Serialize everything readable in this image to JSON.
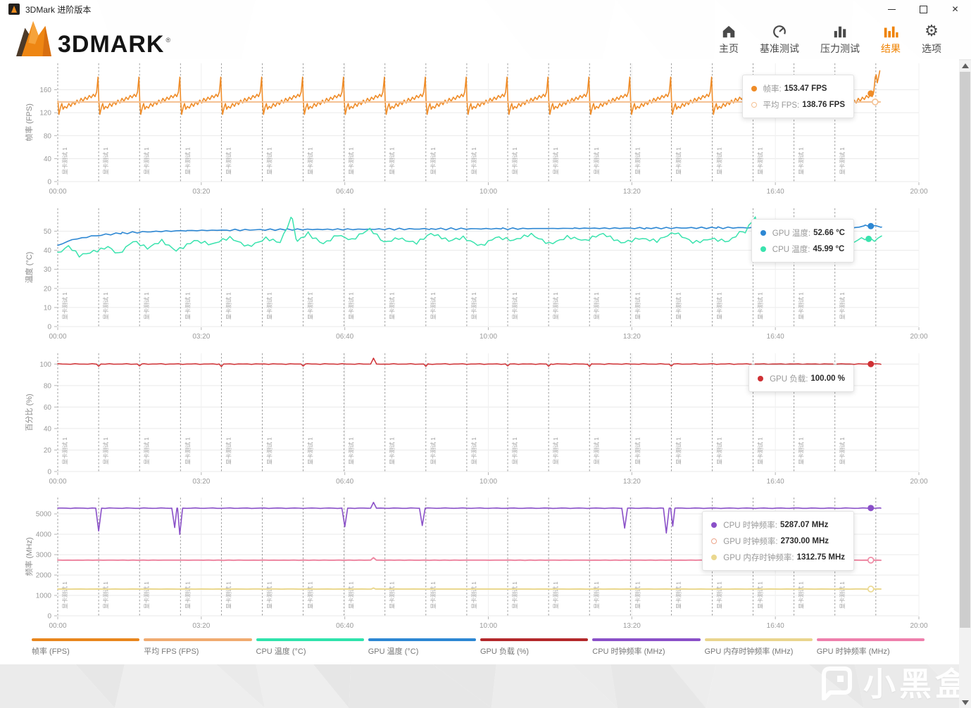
{
  "window": {
    "title": "3DMark 进阶版本",
    "controls": {
      "minimize": "最小化",
      "maximize": "最大化",
      "close": "关闭"
    }
  },
  "header": {
    "logo_text": "3DMARK",
    "reg_mark": "®",
    "nav": [
      {
        "label": "主页",
        "icon": "home-icon",
        "active": false
      },
      {
        "label": "基准测试",
        "icon": "benchmark-icon",
        "active": false
      },
      {
        "label": "压力测试",
        "icon": "stress-test-icon",
        "active": false
      },
      {
        "label": "结果",
        "icon": "results-icon",
        "active": true
      },
      {
        "label": "选项",
        "icon": "options-icon",
        "active": false
      }
    ]
  },
  "accent_color": "#ef8200",
  "loop_marker_label": "显卡测试 1",
  "chart_data": [
    {
      "type": "line",
      "ylabel": "帧率 (FPS)",
      "yticks": [
        0,
        40,
        80,
        120,
        160
      ],
      "ylim": [
        0,
        206
      ],
      "x_ticks": [
        "00:00",
        "03:20",
        "06:40",
        "10:00",
        "13:20",
        "16:40",
        "20:00"
      ],
      "x_range_seconds": [
        0,
        1200
      ],
      "loop_label": "显卡测试 1",
      "loop_period_s": 57,
      "loop_count": 21,
      "legend_rows": [
        {
          "color": "#ef8c28",
          "style": "filled",
          "label": "帧率:",
          "value": "153.47 FPS"
        },
        {
          "color": "#f4c193",
          "style": "hollow",
          "label": "平均 FPS:",
          "value": "138.76 FPS"
        }
      ],
      "series": [
        {
          "name": "帧率 (FPS)",
          "color": "#ef8c28",
          "width": 1.6,
          "data": {
            "kind": "cycle",
            "period": 57,
            "loops": 20,
            "cycle": [
              [
                0.005,
                140
              ],
              [
                0.03,
                117
              ],
              [
                0.07,
                130
              ],
              [
                0.1,
                136
              ],
              [
                0.13,
                126
              ],
              [
                0.17,
                131
              ],
              [
                0.22,
                128
              ],
              [
                0.27,
                136
              ],
              [
                0.32,
                131
              ],
              [
                0.37,
                139
              ],
              [
                0.42,
                134
              ],
              [
                0.47,
                142
              ],
              [
                0.52,
                137
              ],
              [
                0.57,
                145
              ],
              [
                0.62,
                140
              ],
              [
                0.67,
                147
              ],
              [
                0.72,
                143
              ],
              [
                0.77,
                150
              ],
              [
                0.82,
                146
              ],
              [
                0.87,
                152
              ],
              [
                0.91,
                148
              ],
              [
                0.95,
                156
              ],
              [
                0.985,
                182
              ]
            ],
            "tail": [
              [
                1140.5,
                186
              ],
              [
                1142,
                172
              ],
              [
                1143.5,
                180
              ],
              [
                1145.5,
                193
              ]
            ]
          },
          "end_marker": {
            "t": 1133,
            "v": 153.47,
            "style": "filled"
          }
        },
        {
          "name": "平均 FPS (FPS)",
          "color": "#f4c193",
          "width": 2.2,
          "data": {
            "kind": "flat",
            "value": 138.76,
            "from": 0,
            "to": 1146,
            "jitter": 0,
            "step": 40
          },
          "end_marker": {
            "t": 1139,
            "v": 138.76,
            "style": "hollow"
          }
        }
      ]
    },
    {
      "type": "line",
      "ylabel": "温度 (°C)",
      "yticks": [
        0,
        10,
        20,
        30,
        40,
        50
      ],
      "ylim": [
        0,
        62
      ],
      "x_ticks": [
        "00:00",
        "03:20",
        "06:40",
        "10:00",
        "13:20",
        "16:40",
        "20:00"
      ],
      "x_range_seconds": [
        0,
        1200
      ],
      "loop_label": "显卡测试 1",
      "loop_period_s": 57,
      "loop_count": 21,
      "legend_rows": [
        {
          "color": "#2d87d3",
          "style": "filled",
          "label": "GPU 温度:",
          "value": "52.66 °C"
        },
        {
          "color": "#3ae3ae",
          "style": "filled",
          "label": "CPU 温度:",
          "value": "45.99 °C"
        }
      ],
      "series": [
        {
          "name": "GPU 温度 (°C)",
          "color": "#2d87d3",
          "width": 1.6,
          "data": {
            "kind": "points",
            "jitter": 0.5,
            "step": 7,
            "phase": 2.3,
            "points": [
              [
                0,
                42.5
              ],
              [
                20,
                45.5
              ],
              [
                40,
                47
              ],
              [
                60,
                48
              ],
              [
                90,
                49
              ],
              [
                130,
                49.8
              ],
              [
                180,
                50.3
              ],
              [
                240,
                50.6
              ],
              [
                320,
                50.9
              ],
              [
                420,
                51.0
              ],
              [
                520,
                51.2
              ],
              [
                620,
                51.3
              ],
              [
                720,
                51.5
              ],
              [
                820,
                51.6
              ],
              [
                920,
                51.8
              ],
              [
                1000,
                51.9
              ],
              [
                1060,
                52.0
              ],
              [
                1095,
                53.2
              ],
              [
                1110,
                51.8
              ],
              [
                1125,
                52.8
              ],
              [
                1140,
                52.66
              ],
              [
                1148,
                52.2
              ]
            ]
          },
          "end_marker": {
            "t": 1133,
            "v": 52.66,
            "style": "filled"
          }
        },
        {
          "name": "CPU 温度 (°C)",
          "color": "#3ae3ae",
          "width": 1.5,
          "data": {
            "kind": "points",
            "jitter": 1.9,
            "step": 5,
            "phase": 0.7,
            "points": [
              [
                0,
                37.5
              ],
              [
                15,
                41
              ],
              [
                30,
                36.5
              ],
              [
                50,
                40
              ],
              [
                70,
                43
              ],
              [
                85,
                38.5
              ],
              [
                105,
                44
              ],
              [
                125,
                40
              ],
              [
                145,
                45
              ],
              [
                165,
                41
              ],
              [
                190,
                45.5
              ],
              [
                215,
                42
              ],
              [
                240,
                46
              ],
              [
                265,
                43
              ],
              [
                290,
                47
              ],
              [
                310,
                43.5
              ],
              [
                327,
                57
              ],
              [
                334,
                44
              ],
              [
                350,
                48
              ],
              [
                370,
                44.5
              ],
              [
                390,
                49
              ],
              [
                410,
                45
              ],
              [
                435,
                50
              ],
              [
                455,
                44
              ],
              [
                475,
                47.5
              ],
              [
                500,
                44.5
              ],
              [
                520,
                48
              ],
              [
                545,
                44
              ],
              [
                565,
                47
              ],
              [
                590,
                43.5
              ],
              [
                610,
                47
              ],
              [
                635,
                44
              ],
              [
                660,
                48
              ],
              [
                685,
                44.5
              ],
              [
                710,
                47.5
              ],
              [
                735,
                44
              ],
              [
                760,
                48
              ],
              [
                785,
                45
              ],
              [
                810,
                47
              ],
              [
                835,
                44
              ],
              [
                860,
                48.5
              ],
              [
                885,
                45
              ],
              [
                910,
                47
              ],
              [
                935,
                44
              ],
              [
                958,
                50
              ],
              [
                972,
                58
              ],
              [
                980,
                43
              ],
              [
                1000,
                47
              ],
              [
                1020,
                44
              ],
              [
                1040,
                48
              ],
              [
                1060,
                45
              ],
              [
                1080,
                47
              ],
              [
                1100,
                44.5
              ],
              [
                1120,
                47
              ],
              [
                1138,
                45.99
              ],
              [
                1148,
                47.5
              ]
            ]
          },
          "end_marker": {
            "t": 1130,
            "v": 45.99,
            "style": "filled"
          }
        }
      ]
    },
    {
      "type": "line",
      "ylabel": "百分比 (%)",
      "yticks": [
        0,
        20,
        40,
        60,
        80,
        100
      ],
      "ylim": [
        0,
        110
      ],
      "x_ticks": [
        "00:00",
        "03:20",
        "06:40",
        "10:00",
        "13:20",
        "16:40",
        "20:00"
      ],
      "x_range_seconds": [
        0,
        1200
      ],
      "loop_label": "显卡测试 1",
      "loop_period_s": 57,
      "loop_count": 21,
      "legend_rows": [
        {
          "color": "#cf3034",
          "style": "filled",
          "label": "GPU 负载:",
          "value": "100.00 %"
        }
      ],
      "series": [
        {
          "name": "GPU 负载 (%)",
          "color": "#cf3034",
          "width": 1.5,
          "data": {
            "kind": "flat",
            "value": 100,
            "from": 0,
            "to": 1147,
            "jitter": 0.35,
            "step": 6,
            "phase": 1.1,
            "events": [
              {
                "t": 57,
                "v": 97.9,
                "w": 3
              },
              {
                "t": 114,
                "v": 98.2,
                "w": 3
              },
              {
                "t": 228,
                "v": 97.6,
                "w": 3
              },
              {
                "t": 342,
                "v": 98.1,
                "w": 3
              },
              {
                "t": 440,
                "v": 105.5,
                "w": 4
              },
              {
                "t": 513,
                "v": 97.8,
                "w": 3
              },
              {
                "t": 627,
                "v": 98.2,
                "w": 3
              },
              {
                "t": 684,
                "v": 97.9,
                "w": 3
              },
              {
                "t": 741,
                "v": 97.7,
                "w": 3
              },
              {
                "t": 855,
                "v": 98.1,
                "w": 3
              },
              {
                "t": 969,
                "v": 97.7,
                "w": 3
              },
              {
                "t": 1083,
                "v": 98.2,
                "w": 3
              }
            ]
          },
          "end_marker": {
            "t": 1133,
            "v": 100,
            "style": "filled"
          }
        }
      ]
    },
    {
      "type": "line",
      "ylabel": "频率 (MHz)",
      "yticks": [
        0,
        1000,
        2000,
        3000,
        4000,
        5000
      ],
      "ylim": [
        0,
        5800
      ],
      "x_ticks": [
        "00:00",
        "03:20",
        "06:40",
        "10:00",
        "13:20",
        "16:40",
        "20:00"
      ],
      "x_range_seconds": [
        0,
        1200
      ],
      "loop_label": "显卡测试 1",
      "loop_period_s": 57,
      "loop_count": 21,
      "legend_rows": [
        {
          "color": "#8a50c8",
          "style": "filled",
          "label": "CPU 时钟频率:",
          "value": "5287.07 MHz"
        },
        {
          "color": "#eda58b",
          "style": "hollow",
          "label": "GPU 时钟频率:",
          "value": "2730.00 MHz"
        },
        {
          "color": "#ead88f",
          "style": "filled",
          "label": "GPU 内存时钟频率:",
          "value": "1312.75 MHz"
        }
      ],
      "series": [
        {
          "name": "CPU 时钟频率 (MHz)",
          "color": "#8a50c8",
          "width": 1.6,
          "data": {
            "kind": "flat",
            "value": 5280,
            "from": 0,
            "to": 1147,
            "jitter": 18,
            "step": 6,
            "phase": 0.3,
            "events": [
              {
                "t": 57,
                "v": 4160,
                "w": 4
              },
              {
                "t": 163,
                "v": 4330,
                "w": 4
              },
              {
                "t": 170,
                "v": 3990,
                "w": 4
              },
              {
                "t": 400,
                "v": 4370,
                "w": 4
              },
              {
                "t": 440,
                "v": 5565,
                "w": 4
              },
              {
                "t": 508,
                "v": 4430,
                "w": 4
              },
              {
                "t": 790,
                "v": 4300,
                "w": 4
              },
              {
                "t": 848,
                "v": 4060,
                "w": 4
              },
              {
                "t": 857,
                "v": 4400,
                "w": 3
              }
            ]
          },
          "end_marker": {
            "t": 1133,
            "v": 5287.07,
            "style": "filled"
          }
        },
        {
          "name": "GPU 时钟频率 (MHz)",
          "color": "#ee8aa4",
          "width": 2,
          "data": {
            "kind": "flat",
            "value": 2730,
            "from": 0,
            "to": 1147,
            "jitter": 8,
            "step": 7,
            "phase": 1.9,
            "events": [
              {
                "t": 440,
                "v": 2850,
                "w": 4
              }
            ]
          },
          "end_marker": {
            "t": 1133,
            "v": 2730,
            "style": "hollow"
          }
        },
        {
          "name": "GPU 内存时钟频率 (MHz)",
          "color": "#ead88f",
          "width": 2,
          "data": {
            "kind": "flat",
            "value": 1312,
            "from": 0,
            "to": 1147,
            "jitter": 5,
            "step": 8,
            "phase": 2.6,
            "events": [
              {
                "t": 440,
                "v": 1365,
                "w": 3
              }
            ]
          },
          "end_marker": {
            "t": 1133,
            "v": 1312.75,
            "style": "hollow"
          }
        }
      ]
    }
  ],
  "bottom_legend": [
    {
      "label": "帧率 (FPS)",
      "color": "#e8861d"
    },
    {
      "label": "平均 FPS (FPS)",
      "color": "#f0ab70"
    },
    {
      "label": "CPU 温度 (°C)",
      "color": "#2fe3ac"
    },
    {
      "label": "GPU 温度 (°C)",
      "color": "#2d87d3"
    },
    {
      "label": "GPU 负载 (%)",
      "color": "#b3282b"
    },
    {
      "label": "CPU 时钟频率 (MHz)",
      "color": "#8a50c8"
    },
    {
      "label": "GPU 内存时钟频率 (MHz)",
      "color": "#e9d58d"
    },
    {
      "label": "GPU 时钟频率 (MHz)",
      "color": "#ee7fac"
    }
  ],
  "watermark": {
    "text": "小黑盒"
  }
}
